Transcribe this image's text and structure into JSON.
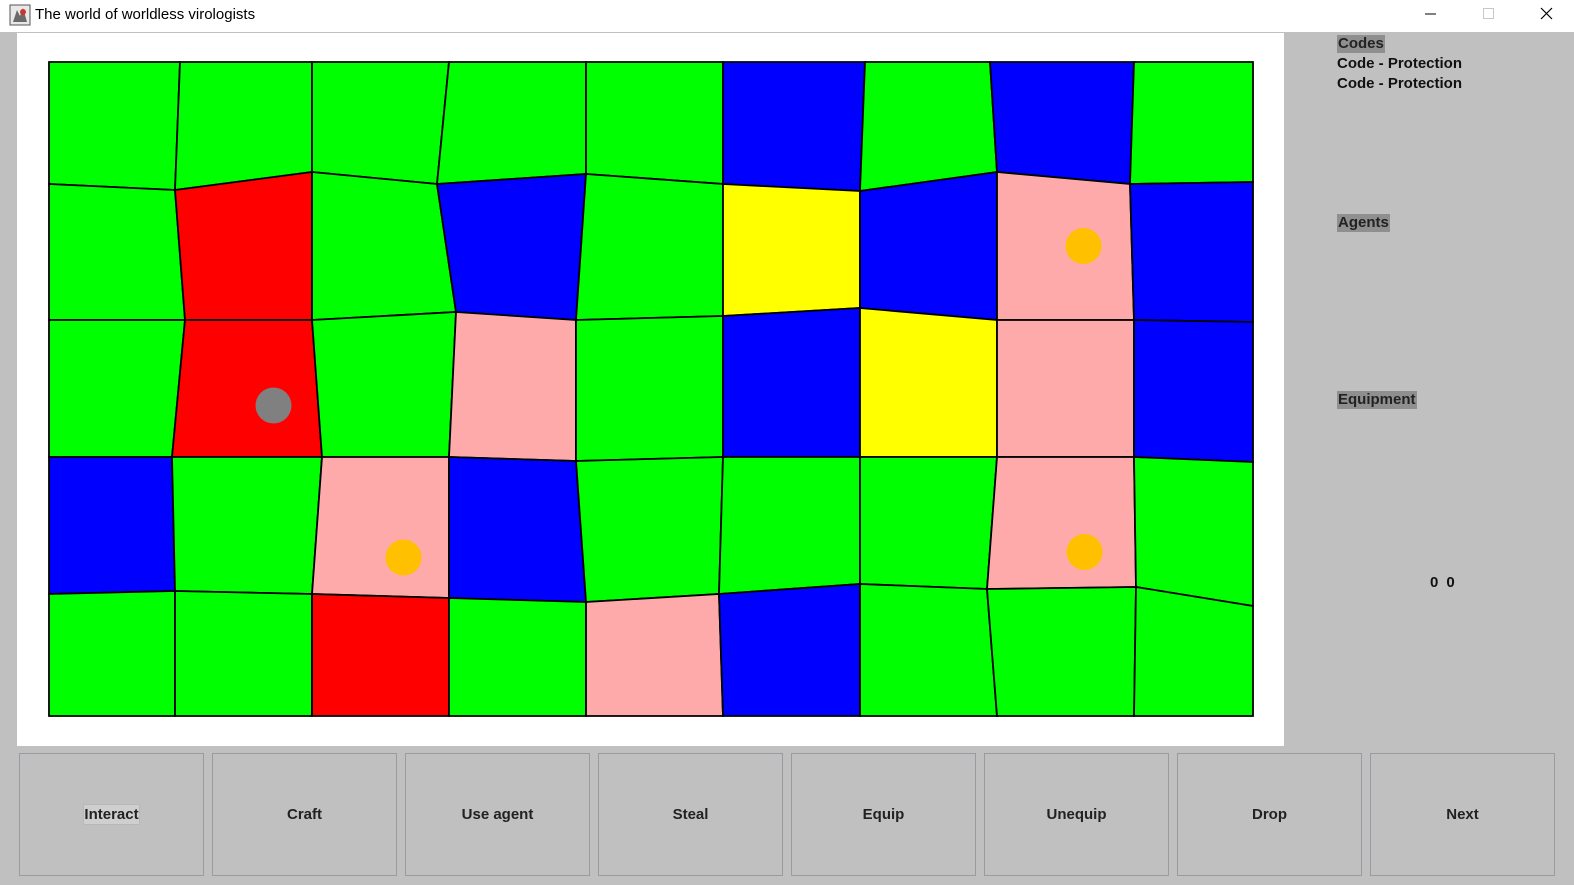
{
  "window": {
    "title": "The world of worldless virologists",
    "app_icon": "virologist-app-icon",
    "controls": [
      "minimize-icon",
      "maximize-icon",
      "close-icon"
    ]
  },
  "colors": {
    "field": "#00ff00",
    "laboratory": "#ff0000",
    "warehouse": "#0000ff",
    "shelter": "#ffff00",
    "pink": "#ffaaaa",
    "virologist_player": "#808080",
    "virologist_other": "#ffc000"
  },
  "board": {
    "rows": 5,
    "cols": 9,
    "tiles": [
      [
        "field",
        "field",
        "field",
        "field",
        "field",
        "warehouse",
        "field",
        "warehouse",
        "field"
      ],
      [
        "field",
        "laboratory",
        "field",
        "warehouse",
        "field",
        "shelter",
        "warehouse",
        "pink",
        "warehouse"
      ],
      [
        "field",
        "laboratory",
        "field",
        "pink",
        "field",
        "warehouse",
        "shelter",
        "pink",
        "warehouse"
      ],
      [
        "warehouse",
        "field",
        "pink",
        "warehouse",
        "field",
        "field",
        "field",
        "pink",
        "field"
      ],
      [
        "field",
        "field",
        "laboratory",
        "field",
        "pink",
        "warehouse",
        "field",
        "field",
        "field"
      ]
    ],
    "virologists": [
      {
        "row": 2,
        "col": 1,
        "kind": "player"
      },
      {
        "row": 1,
        "col": 7,
        "kind": "other"
      },
      {
        "row": 3,
        "col": 2,
        "kind": "other"
      },
      {
        "row": 3,
        "col": 7,
        "kind": "other"
      }
    ]
  },
  "side_panel": {
    "codes_heading": "Codes",
    "codes": [
      "Code - Protection",
      "Code - Protection"
    ],
    "agents_heading": "Agents",
    "equipment_heading": "Equipment",
    "coord_x": "0",
    "coord_y": "0"
  },
  "actions": {
    "interact": "Interact",
    "craft": "Craft",
    "use_agent": "Use agent",
    "steal": "Steal",
    "equip": "Equip",
    "unequip": "Unequip",
    "drop": "Drop",
    "next": "Next"
  }
}
